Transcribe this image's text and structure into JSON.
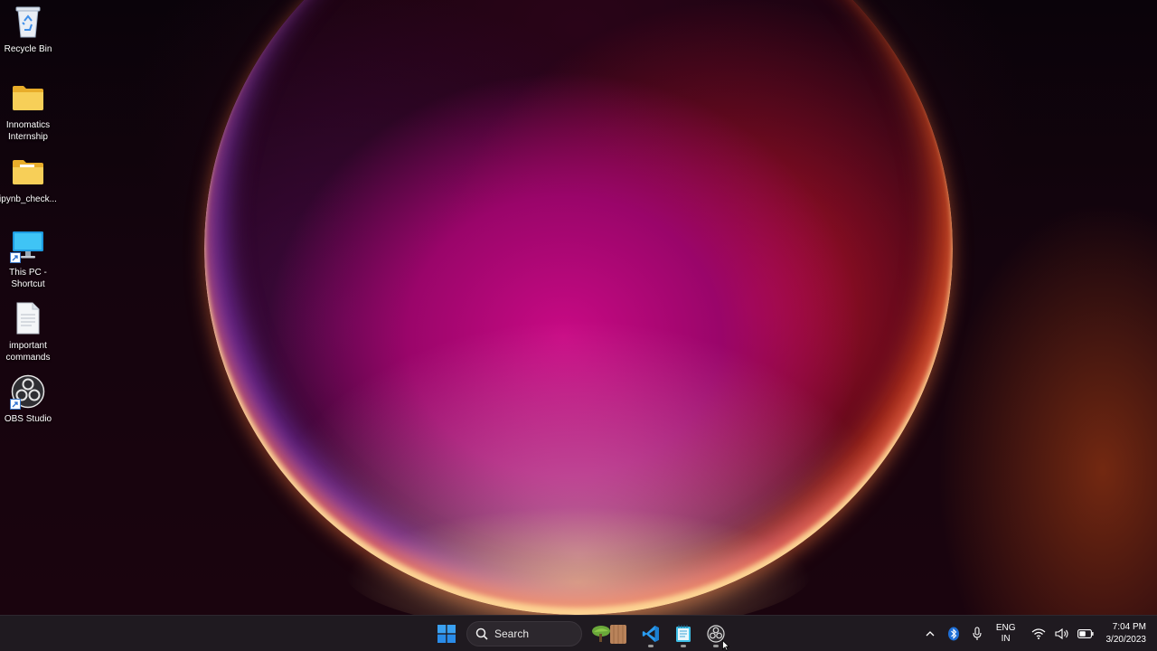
{
  "desktop": {
    "icons": [
      {
        "label": "Recycle Bin"
      },
      {
        "label": "Innomatics Internship"
      },
      {
        "label": "ipynb_check..."
      },
      {
        "label": "This PC - Shortcut"
      },
      {
        "label": "important commands"
      },
      {
        "label": "OBS Studio"
      }
    ]
  },
  "taskbar": {
    "search": {
      "placeholder": "Search"
    },
    "apps": [
      {
        "icon": "start-windows-icon"
      },
      {
        "icon": "widgets-icon"
      },
      {
        "icon": "vscode-icon",
        "running": true
      },
      {
        "icon": "notepad-icon",
        "running": true
      },
      {
        "icon": "obs-studio-icon",
        "running": true
      }
    ],
    "tray": {
      "lang_line1": "ENG",
      "lang_line2": "IN",
      "time": "7:04 PM",
      "date": "3/20/2023"
    }
  },
  "colors": {
    "taskbar_bg": "#1f1a20",
    "folder_yellow": "#f5c542",
    "accent_blue": "#2a8cf0"
  }
}
